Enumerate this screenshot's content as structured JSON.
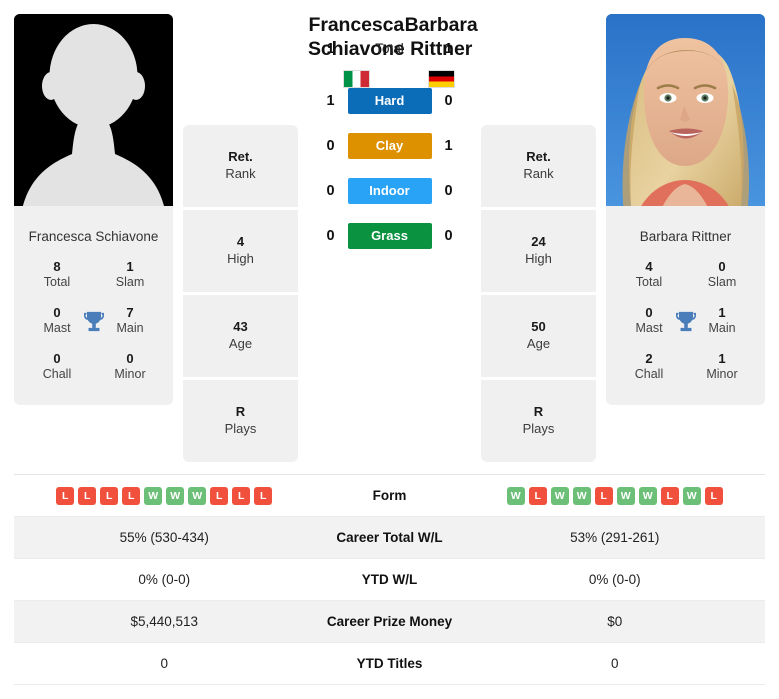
{
  "players": {
    "left": {
      "first_name": "Francesca",
      "last_name": "Schiavone",
      "full_name": "Francesca Schiavone",
      "country": "Italy",
      "flag_icon": "flag-italy-icon",
      "photo_type": "placeholder-avatar",
      "titles": {
        "total": "8",
        "total_label": "Total",
        "slam": "1",
        "slam_label": "Slam",
        "mast": "0",
        "mast_label": "Mast",
        "main": "7",
        "main_label": "Main",
        "chall": "0",
        "chall_label": "Chall",
        "minor": "0",
        "minor_label": "Minor"
      },
      "info": [
        {
          "value": "Ret.",
          "label": "Rank"
        },
        {
          "value": "4",
          "label": "High"
        },
        {
          "value": "43",
          "label": "Age"
        },
        {
          "value": "R",
          "label": "Plays"
        }
      ],
      "form": [
        "L",
        "L",
        "L",
        "L",
        "W",
        "W",
        "W",
        "L",
        "L",
        "L"
      ],
      "career_total_wl": "55% (530-434)",
      "ytd_wl": "0% (0-0)",
      "career_prize_money": "$5,440,513",
      "ytd_titles": "0"
    },
    "right": {
      "first_name": "Barbara",
      "last_name": "Rittner",
      "full_name": "Barbara Rittner",
      "country": "Germany",
      "flag_icon": "flag-germany-icon",
      "photo_type": "portrait-photo",
      "titles": {
        "total": "4",
        "total_label": "Total",
        "slam": "0",
        "slam_label": "Slam",
        "mast": "0",
        "mast_label": "Mast",
        "main": "1",
        "main_label": "Main",
        "chall": "2",
        "chall_label": "Chall",
        "minor": "1",
        "minor_label": "Minor"
      },
      "info": [
        {
          "value": "Ret.",
          "label": "Rank"
        },
        {
          "value": "24",
          "label": "High"
        },
        {
          "value": "50",
          "label": "Age"
        },
        {
          "value": "R",
          "label": "Plays"
        }
      ],
      "form": [
        "W",
        "L",
        "W",
        "W",
        "L",
        "W",
        "W",
        "L",
        "W",
        "L"
      ],
      "career_total_wl": "53% (291-261)",
      "ytd_wl": "0% (0-0)",
      "career_prize_money": "$0",
      "ytd_titles": "0"
    }
  },
  "head_to_head": {
    "surfaces": [
      {
        "key": "total",
        "label": "Total",
        "left": "1",
        "right": "1",
        "color": "transparent"
      },
      {
        "key": "hard",
        "label": "Hard",
        "left": "1",
        "right": "0",
        "color": "#0b6cb8"
      },
      {
        "key": "clay",
        "label": "Clay",
        "left": "0",
        "right": "1",
        "color": "#dd9000"
      },
      {
        "key": "indoor",
        "label": "Indoor",
        "left": "0",
        "right": "0",
        "color": "#29a3f5"
      },
      {
        "key": "grass",
        "label": "Grass",
        "left": "0",
        "right": "0",
        "color": "#0a9240"
      }
    ]
  },
  "table": {
    "rows": [
      {
        "label": "Form",
        "type": "form",
        "left": "",
        "right": ""
      },
      {
        "label": "Career Total W/L",
        "type": "text",
        "left": "55% (530-434)",
        "right": "53% (291-261)"
      },
      {
        "label": "YTD W/L",
        "type": "text",
        "left": "0% (0-0)",
        "right": "0% (0-0)"
      },
      {
        "label": "Career Prize Money",
        "type": "text",
        "left": "$5,440,513",
        "right": "$0"
      },
      {
        "label": "YTD Titles",
        "type": "text",
        "left": "0",
        "right": "0"
      }
    ]
  },
  "icons": {
    "trophy": "trophy-icon"
  },
  "colors": {
    "hard": "#0b6cb8",
    "clay": "#dd9000",
    "indoor": "#29a3f5",
    "grass": "#0a9240",
    "win_badge": "#6cbf77",
    "loss_badge": "#f0503c",
    "card_bg": "#f0f0f0",
    "trophy": "#4a7ebb"
  }
}
